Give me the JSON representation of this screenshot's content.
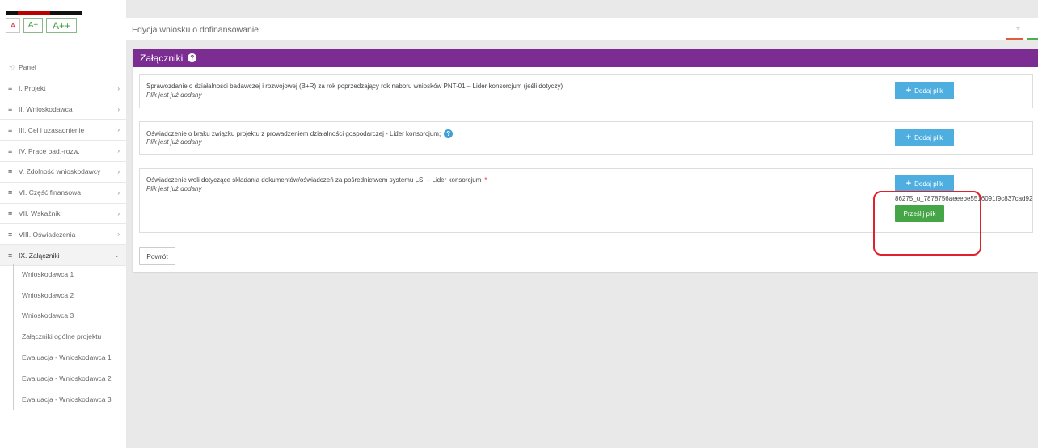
{
  "font_size_buttons": [
    "A",
    "A+",
    "A++"
  ],
  "sidebar": {
    "items": [
      {
        "label": "Panel",
        "icon": "home-icon"
      },
      {
        "label": "I. Projekt",
        "icon": "list-icon"
      },
      {
        "label": "II. Wnioskodawca",
        "icon": "list-icon"
      },
      {
        "label": "III. Cel i uzasadnienie",
        "icon": "list-icon"
      },
      {
        "label": "IV. Prace bad.-rozw.",
        "icon": "list-icon"
      },
      {
        "label": "V. Zdolność wnioskodawcy",
        "icon": "list-icon"
      },
      {
        "label": "VI. Część finansowa",
        "icon": "list-icon"
      },
      {
        "label": "VII. Wskaźniki",
        "icon": "list-icon"
      },
      {
        "label": "VIII. Oświadczenia",
        "icon": "list-icon"
      },
      {
        "label": "IX. Załączniki",
        "icon": "list-icon"
      }
    ],
    "sub_items": [
      "Wnioskodawca 1",
      "Wnioskodawca 2",
      "Wnioskodawca 3",
      "Załączniki ogólne projektu",
      "Ewaluacja - Wnioskodawca 1",
      "Ewaluacja - Wnioskodawca 2",
      "Ewaluacja - Wnioskodawca 3"
    ]
  },
  "page": {
    "title": "Edycja wniosku o dofinansowanie",
    "section_title": "Załączniki"
  },
  "attachments": [
    {
      "description": "Sprawozdanie o działalności badawczej i rozwojowej (B+R) za rok poprzedzający rok naboru wniosków PNT-01 – Lider konsorcjum (jeśli dotyczy)",
      "note": "Plik jest już dodany",
      "add_label": "Dodaj plik"
    },
    {
      "description": "Oświadczenie o braku związku projektu z prowadzeniem działalności gospodarczej - Lider konsorcjum;",
      "note": "Plik jest już dodany",
      "add_label": "Dodaj plik"
    },
    {
      "description": "Oświadczenie woli dotyczące składania dokumentów/oświadczeń za pośrednictwem systemu LSI – Lider konsorcjum",
      "required_mark": "*",
      "note": "Plik jest już dodany",
      "add_label": "Dodaj plik",
      "file_name": "86275_u_7878756aeeebe5516091f9c837cad92",
      "upload_label": "Prześlij plik"
    }
  ],
  "back_label": "Powrót",
  "colors": {
    "section_header": "#7b2d91",
    "add_button": "#4eaee0",
    "upload_button": "#46a546",
    "highlight": "#e0202a"
  }
}
